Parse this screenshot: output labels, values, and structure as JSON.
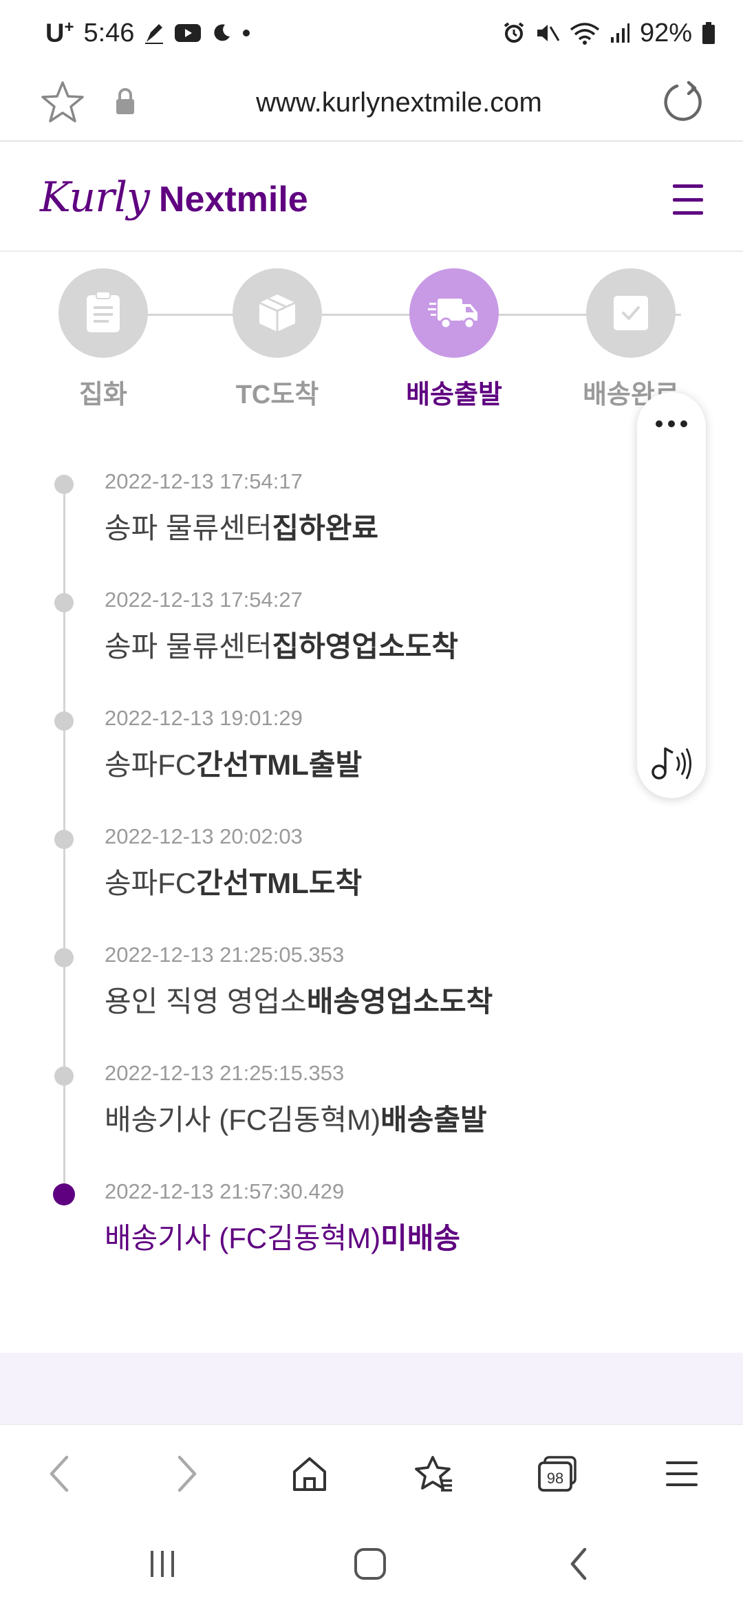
{
  "status_bar": {
    "carrier": "U",
    "carrier_sup": "+",
    "time": "5:46",
    "battery": "92%"
  },
  "browser": {
    "url": "www.kurlynextmile.com",
    "tabs_count": "98"
  },
  "site": {
    "logo_script": "Kurly",
    "logo_word": "Nextmile",
    "brand_color": "#5f0080"
  },
  "steps": [
    {
      "label": "집화",
      "icon": "clipboard-icon",
      "active": false
    },
    {
      "label": "TC도착",
      "icon": "box-icon",
      "active": false
    },
    {
      "label": "배송출발",
      "icon": "truck-icon",
      "active": true
    },
    {
      "label": "배송완료",
      "icon": "checkbox-icon",
      "active": false
    }
  ],
  "timeline": [
    {
      "time": "2022-12-13 17:54:17",
      "place": "송파 물류센터",
      "status": "집하완료"
    },
    {
      "time": "2022-12-13 17:54:27",
      "place": "송파 물류센터",
      "status": "집하영업소도착"
    },
    {
      "time": "2022-12-13 19:01:29",
      "place": "송파FC",
      "status": "간선TML출발"
    },
    {
      "time": "2022-12-13 20:02:03",
      "place": "송파FC",
      "status": "간선TML도착"
    },
    {
      "time": "2022-12-13 21:25:05.353",
      "place": "용인 직영 영업소",
      "status": "배송영업소도착"
    },
    {
      "time": "2022-12-13 21:25:15.353",
      "place": "배송기사 (FC김동혁M)",
      "status": "배송출발"
    },
    {
      "time": "2022-12-13 21:57:30.429",
      "place": "배송기사 (FC김동혁M)",
      "status": "미배송"
    }
  ]
}
